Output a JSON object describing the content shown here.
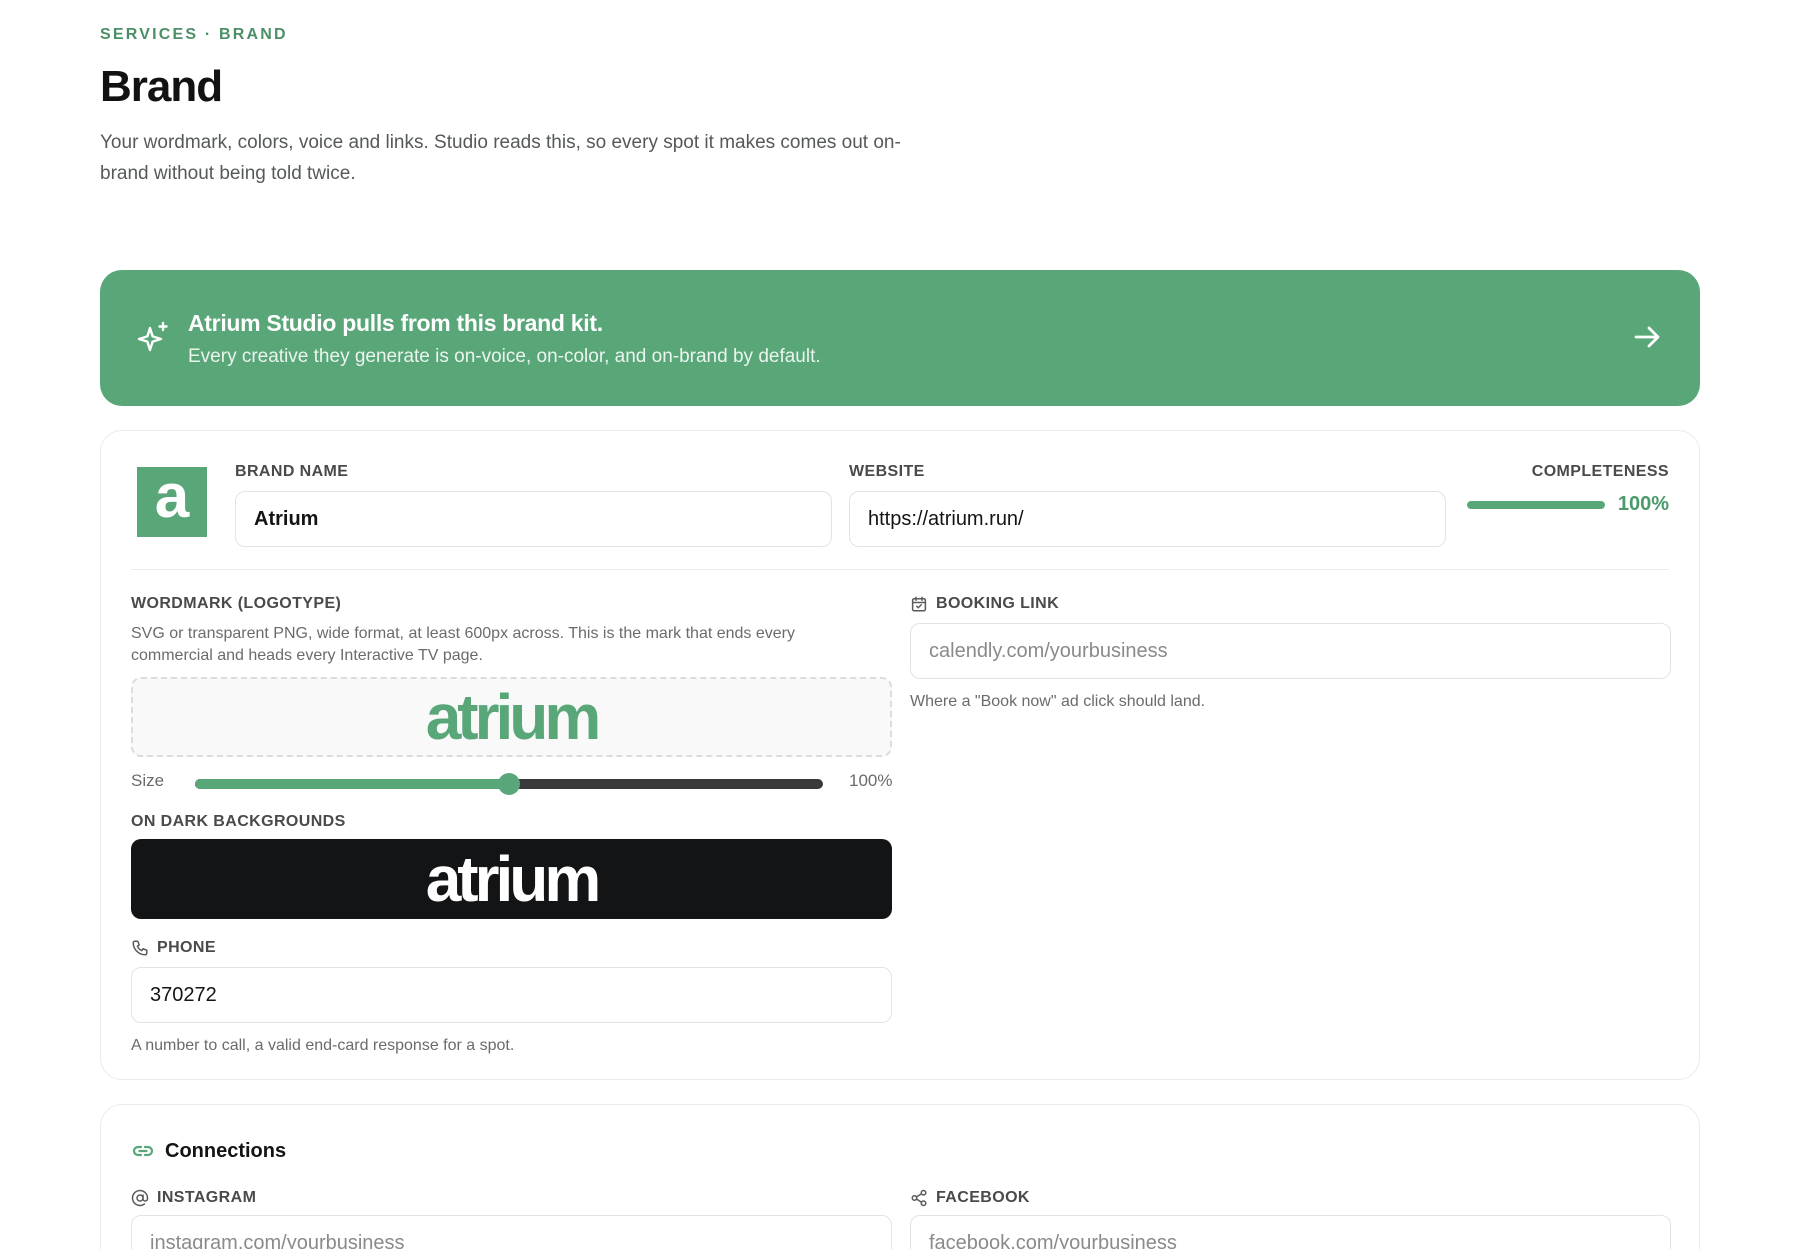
{
  "header": {
    "eyebrow": "SERVICES · BRAND",
    "title": "Brand",
    "description": "Your wordmark, colors, voice and links. Studio reads this, so every spot it makes comes out on-brand without being told twice."
  },
  "banner": {
    "title": "Atrium Studio pulls from this brand kit.",
    "subtitle": "Every creative they generate is on-voice, on-color, and on-brand by default.",
    "icon": "sparkle-icon",
    "action_icon": "arrow-right-icon"
  },
  "brand": {
    "logo_letter": "a",
    "brand_name_label": "BRAND NAME",
    "brand_name_value": "Atrium",
    "website_label": "WEBSITE",
    "website_value": "https://atrium.run/",
    "completeness_label": "COMPLETENESS",
    "completeness_value": "100%",
    "completeness_fraction": 1.0
  },
  "wordmark": {
    "label": "WORDMARK (LOGOTYPE)",
    "help": "SVG or transparent PNG, wide format, at least 600px across. This is the mark that ends every commercial and heads every Interactive TV page.",
    "text": "atrium",
    "size_label": "Size",
    "size_value": "100%",
    "slider_fraction": 0.5,
    "dark_label": "ON DARK BACKGROUNDS",
    "dark_text": "atrium"
  },
  "booking": {
    "label": "BOOKING LINK",
    "placeholder": "calendly.com/yourbusiness",
    "help": "Where a \"Book now\" ad click should land."
  },
  "phone": {
    "label": "PHONE",
    "value": "370272",
    "help": "A number to call, a valid end-card response for a spot."
  },
  "connections": {
    "title": "Connections",
    "instagram_label": "INSTAGRAM",
    "instagram_placeholder": "instagram.com/yourbusiness",
    "facebook_label": "FACEBOOK",
    "facebook_placeholder": "facebook.com/yourbusiness"
  },
  "colors": {
    "brand_green": "#59a679",
    "eyebrow_green": "#4b8f66",
    "dark_bg": "#121416"
  }
}
